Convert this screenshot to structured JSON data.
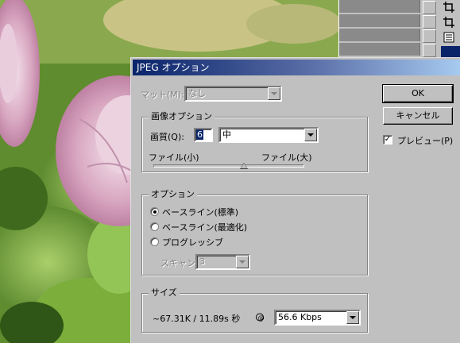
{
  "dialog": {
    "title": "JPEG オプション",
    "matte_label": "マット(M):",
    "matte_value": "なし",
    "image_options_group": "画像オプション",
    "quality_label": "画質(Q):",
    "quality_value": "6",
    "quality_preset": "中",
    "small_file_label": "ファイル(小)",
    "large_file_label": "ファイル(大)",
    "quality_slider_level": 0.6,
    "format_group": "オプション",
    "format_options": [
      {
        "label": "ベースライン(標準)",
        "selected": true
      },
      {
        "label": "ベースライン(最適化)",
        "selected": false
      },
      {
        "label": "プログレッシブ",
        "selected": false
      }
    ],
    "scan_label": "スキャン",
    "scan_value": "3",
    "size_group": "サイズ",
    "size_text": "~67.31K / 11.89s 秒",
    "speed_label": "@",
    "speed_value": "56.6 Kbps",
    "ok_label": "OK",
    "cancel_label": "キャンセル",
    "preview_label": "プレビュー(P)",
    "preview_checked": true
  },
  "palette": {
    "icons": [
      "crop-icon",
      "crop-icon",
      "note-icon"
    ]
  },
  "colors": {
    "dialog_face": "#c0c0c0",
    "titlebar_start": "#0a246a",
    "titlebar_end": "#a6caf0"
  }
}
